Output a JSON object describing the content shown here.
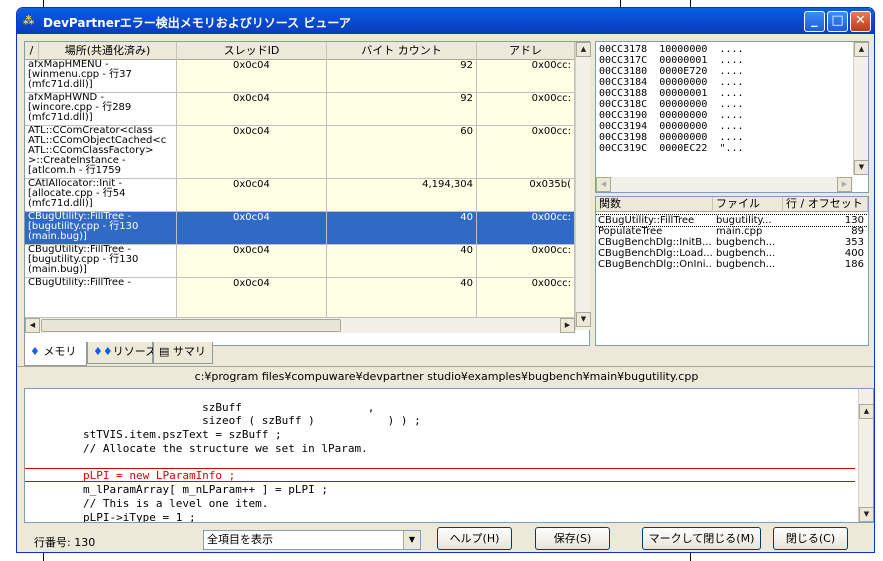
{
  "window": {
    "title": "DevPartnerエラー検出メモリおよびリソース ビューア",
    "min": "_",
    "max": "□",
    "close": "✕"
  },
  "grid": {
    "headers": [
      "場所(共通化済み)",
      "スレッドID",
      "バイト カウント",
      "アドレ"
    ],
    "sort_indicator": "/",
    "rows": [
      {
        "loc": "afxMapHMENU -\n[winmenu.cpp - 行37\n(mfc71d.dll)]",
        "tid": "0x0c04",
        "bytes": "92",
        "addr": "0x00cc:"
      },
      {
        "loc": "afxMapHWND -\n[wincore.cpp - 行289\n(mfc71d.dll)]",
        "tid": "0x0c04",
        "bytes": "92",
        "addr": "0x00cc:"
      },
      {
        "loc": "ATL::CComCreator<class\nATL::CComObjectCached<c\nATL::CComClassFactory>\n>::CreateInstance -\n[atlcom.h - 行1759",
        "tid": "0x0c04",
        "bytes": "60",
        "addr": "0x00cc:"
      },
      {
        "loc": "CAtlAllocator::Init -\n[allocate.cpp - 行54\n(mfc71d.dll)]",
        "tid": "0x0c04",
        "bytes": "4,194,304",
        "addr": "0x035b("
      },
      {
        "loc": "CBugUtility::FillTree -\n[bugutility.cpp - 行130\n(main.bug)]",
        "tid": "0x0c04",
        "bytes": "40",
        "addr": "0x00cc:"
      },
      {
        "loc": "CBugUtility::FillTree -\n[bugutility.cpp - 行130\n(main.bug)]",
        "tid": "0x0c04",
        "bytes": "40",
        "addr": "0x00cc:"
      },
      {
        "loc": "CBugUtility::FillTree -",
        "tid": "0x0c04",
        "bytes": "40",
        "addr": "0x00cc:"
      }
    ],
    "selected_index": 4
  },
  "tabs": [
    {
      "label": "メモリ"
    },
    {
      "label": "リソース"
    },
    {
      "label": "サマリ"
    }
  ],
  "memory": [
    {
      "addr": "00CC3178",
      "val": "10000000",
      "ascii": "...."
    },
    {
      "addr": "00CC317C",
      "val": "00000001",
      "ascii": "...."
    },
    {
      "addr": "00CC3180",
      "val": "0000E720",
      "ascii": "...."
    },
    {
      "addr": "00CC3184",
      "val": "00000000",
      "ascii": "...."
    },
    {
      "addr": "00CC3188",
      "val": "00000001",
      "ascii": "...."
    },
    {
      "addr": "00CC318C",
      "val": "00000000",
      "ascii": "...."
    },
    {
      "addr": "00CC3190",
      "val": "00000000",
      "ascii": "...."
    },
    {
      "addr": "00CC3194",
      "val": "00000000",
      "ascii": "...."
    },
    {
      "addr": "00CC3198",
      "val": "00000000",
      "ascii": "...."
    },
    {
      "addr": "00CC319C",
      "val": "0000EC22",
      "ascii": "\"..."
    }
  ],
  "stack": {
    "headers": [
      "関数",
      "ファイル",
      "行 / オフセット"
    ],
    "rows": [
      {
        "fn": "CBugUtility::FillTree",
        "file": "bugutility...",
        "line": "130"
      },
      {
        "fn": "PopulateTree",
        "file": "main.cpp",
        "line": "89"
      },
      {
        "fn": "CBugBenchDlg::InitB...",
        "file": "bugbench...",
        "line": "353"
      },
      {
        "fn": "CBugBenchDlg::Load...",
        "file": "bugbench...",
        "line": "400"
      },
      {
        "fn": "CBugBenchDlg::OnIni...",
        "file": "bugbench...",
        "line": "186"
      }
    ]
  },
  "source": {
    "path": "c:¥program files¥compuware¥devpartner studio¥examples¥bugbench¥main¥bugutility.cpp",
    "lines": [
      "                          szBuff                   ,",
      "                          sizeof ( szBuff )           ) ) ;",
      "        stTVIS.item.pszText = szBuff ;",
      "        // Allocate the structure we set in lParam.",
      "        pLPI = new LParamInfo ;",
      "        m_lParamArray[ m_nLParam++ ] = pLPI ;",
      "        // This is a level one item.",
      "        pLPI->iType = 1 ;"
    ],
    "error_line_index": 4
  },
  "status": {
    "line_number": "行番号: 130",
    "filter": "全項目を表示"
  },
  "buttons": {
    "help": "ヘルプ(H)",
    "save": "保存(S)",
    "mark_close": "マークして閉じる(M)",
    "close": "閉じる(C)"
  }
}
